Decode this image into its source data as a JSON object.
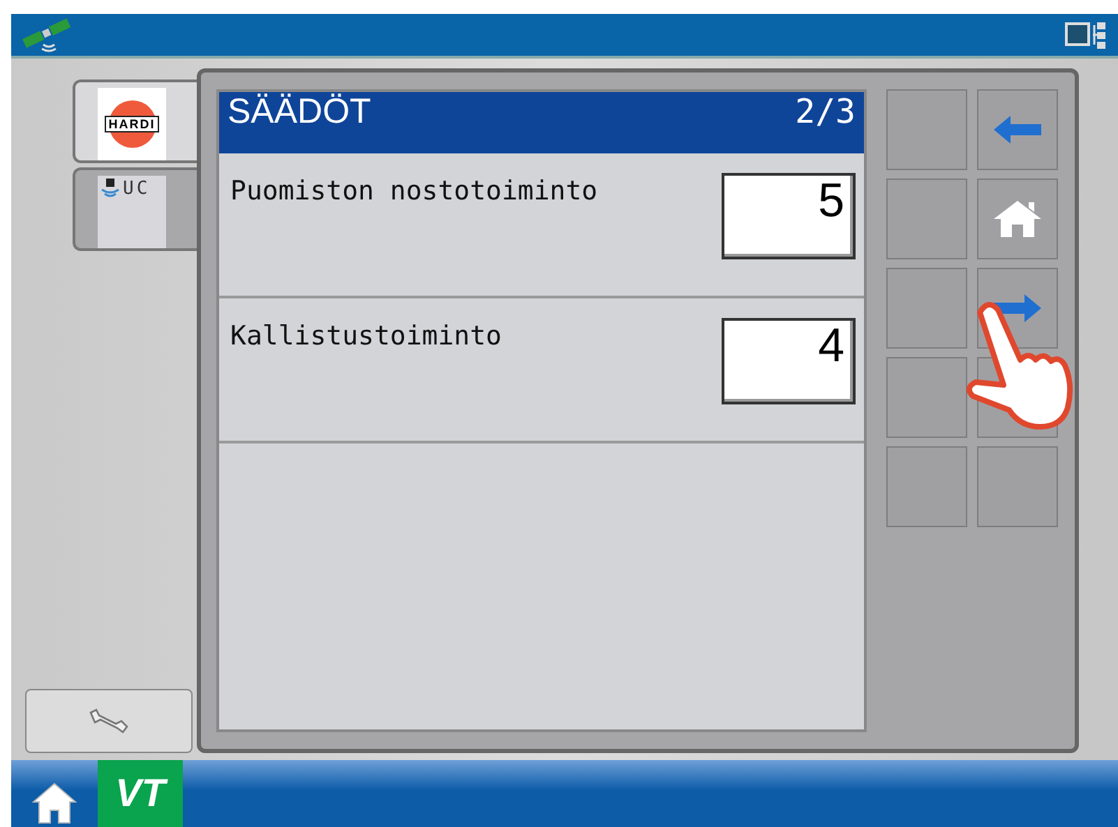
{
  "side_tabs": [
    {
      "kind": "logo",
      "label": "HARDI",
      "selected": true
    },
    {
      "kind": "uc",
      "label": "UC",
      "selected": false
    }
  ],
  "panel": {
    "title": "SÄÄDÖT",
    "page": "2/3",
    "rows": [
      {
        "label": "Puomiston nostotoiminto",
        "value": "5"
      },
      {
        "label": "Kallistustoiminto",
        "value": "4"
      }
    ]
  },
  "softkeys": [
    {
      "kind": "empty"
    },
    {
      "kind": "back"
    },
    {
      "kind": "empty"
    },
    {
      "kind": "home"
    },
    {
      "kind": "empty"
    },
    {
      "kind": "next"
    },
    {
      "kind": "empty"
    },
    {
      "kind": "empty"
    },
    {
      "kind": "empty"
    },
    {
      "kind": "empty"
    }
  ],
  "taskbar": {
    "vt_label": "VT"
  }
}
